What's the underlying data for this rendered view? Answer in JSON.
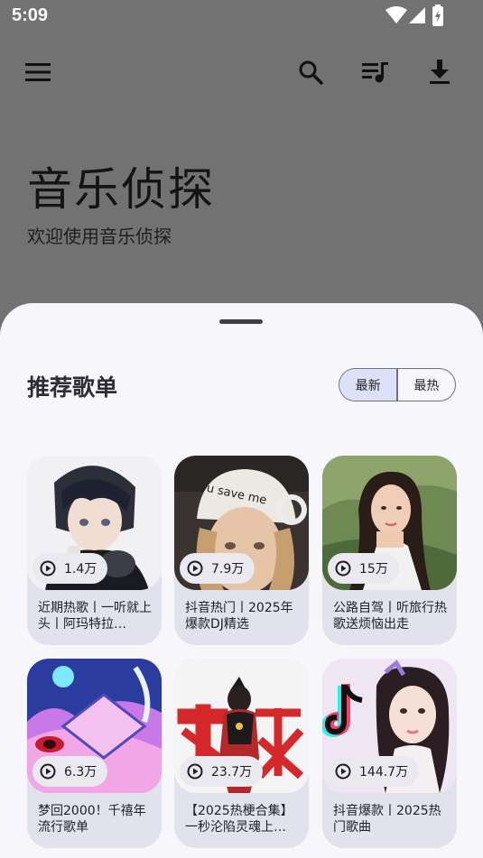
{
  "status_bar": {
    "time": "5:09"
  },
  "toolbar": {
    "menu_icon": "menu-icon",
    "search_icon": "search-icon",
    "queue_icon": "queue-music-icon",
    "download_icon": "download-icon"
  },
  "hero": {
    "title": "音乐侦探",
    "subtitle": "欢迎使用音乐侦探"
  },
  "sheet": {
    "section_title": "推荐歌单",
    "tabs": [
      {
        "label": "最新",
        "active": true
      },
      {
        "label": "最热",
        "active": false
      }
    ],
    "playlists": [
      {
        "title": "近期热歌丨一听就上头丨阿玛特拉…",
        "play_count": "1.4万"
      },
      {
        "title": "抖音热门丨2025年爆款DJ精选",
        "play_count": "7.9万"
      },
      {
        "title": "公路自驾丨听旅行热歌送烦恼出走",
        "play_count": "15万"
      },
      {
        "title": "梦回2000！千禧年流行歌单",
        "play_count": "6.3万"
      },
      {
        "title": "【2025热梗合集】一秒沦陷灵魂上…",
        "play_count": "23.7万"
      },
      {
        "title": "抖音爆款丨2025热门歌曲",
        "play_count": "144.7万"
      }
    ]
  },
  "colors": {
    "scrim": "#727272",
    "sheet_bg": "#f6f6fb",
    "card_bg": "#e1e2ec",
    "active_tab": "#dde1f7"
  }
}
